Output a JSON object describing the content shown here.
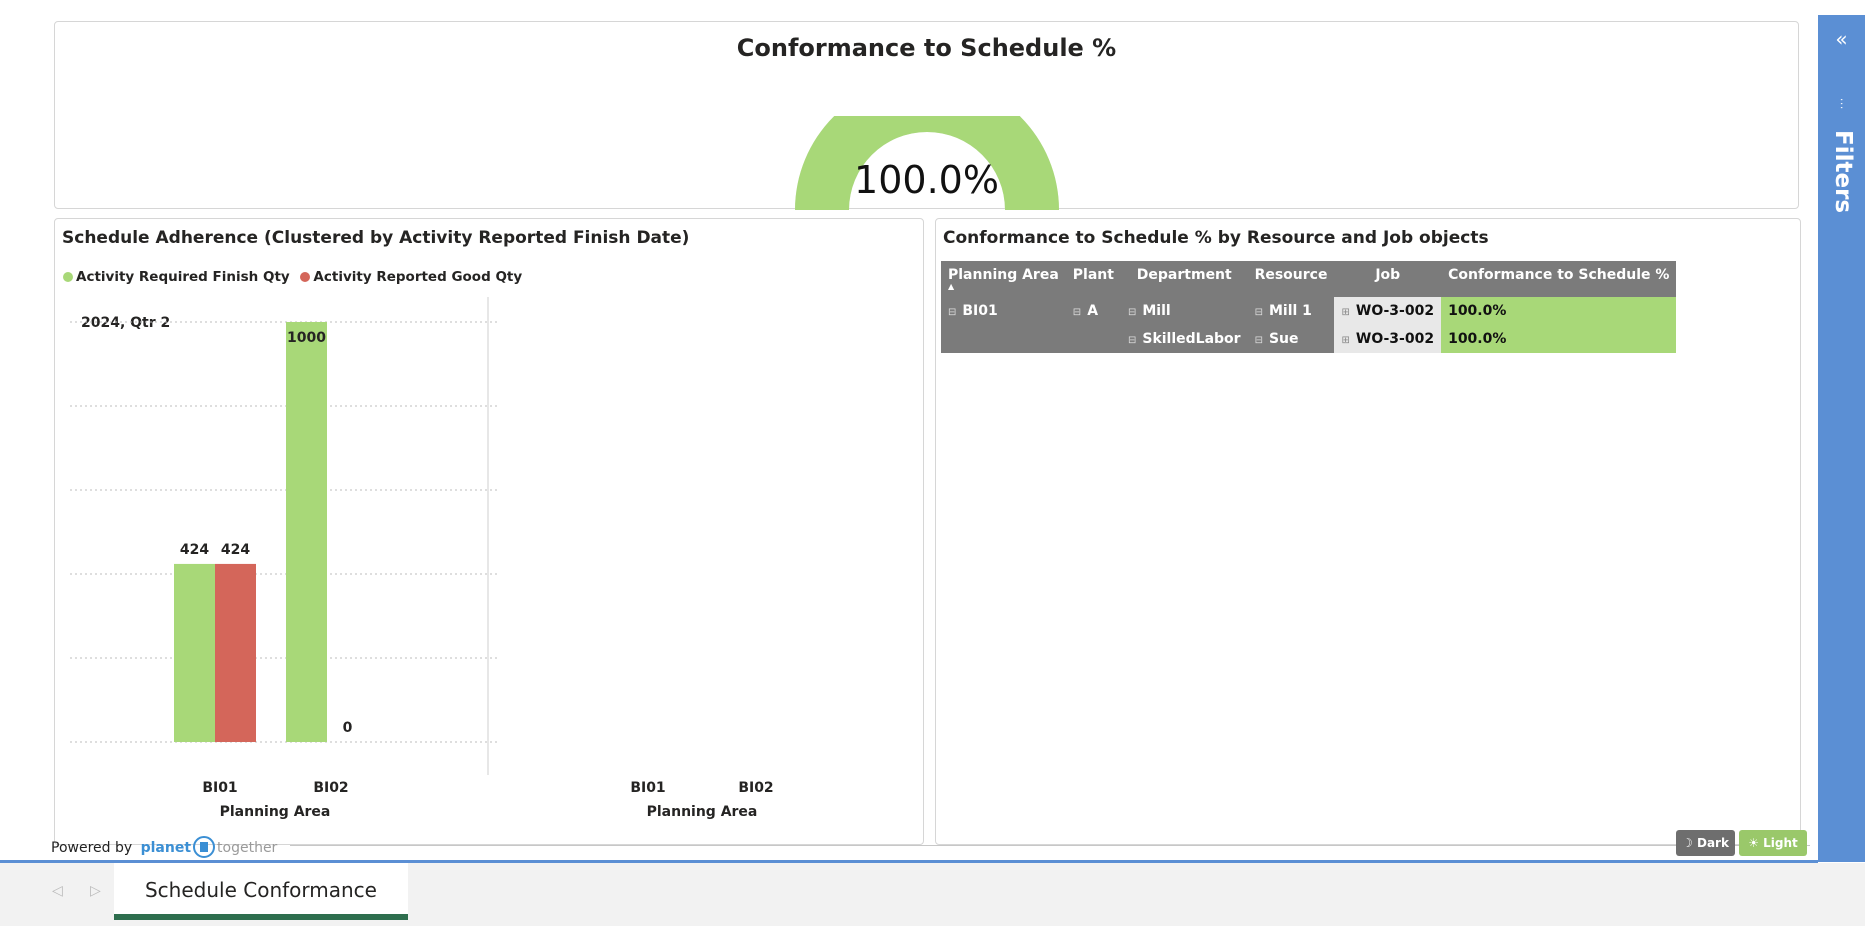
{
  "gauge": {
    "title": "Conformance to Schedule %",
    "value_label": "100.0%",
    "value_fraction": 1.0,
    "fill_color": "#a8d878"
  },
  "chart_card": {
    "title": "Schedule Adherence (Clustered by Activity Reported Finish Date)"
  },
  "chart_data": {
    "type": "bar",
    "period_label": "2024, Qtr 2",
    "categories": [
      "BI01",
      "BI02"
    ],
    "empty_panel_categories": [
      "BI01",
      "BI02"
    ],
    "xlabel": "Planning Area",
    "ylim": [
      0,
      1000
    ],
    "grid": true,
    "legend_position": "top-left",
    "series": [
      {
        "name": "Activity Required Finish Qty",
        "color": "#a8d878",
        "values": [
          424,
          1000
        ]
      },
      {
        "name": "Activity Reported Good Qty",
        "color": "#d4665a",
        "values": [
          424,
          0
        ]
      }
    ]
  },
  "table_card": {
    "title": "Conformance to Schedule % by Resource and Job objects",
    "columns": [
      "Planning Area",
      "Plant",
      "Department",
      "Resource",
      "Job",
      "Conformance to Schedule %"
    ],
    "rows": [
      {
        "planning_area": "BI01",
        "plant": "A",
        "department": "Mill",
        "resource": "Mill 1",
        "job": "WO-3-002",
        "conformance": "100.0%"
      },
      {
        "planning_area": "",
        "plant": "",
        "department": "SkilledLabor",
        "resource": "Sue",
        "job": "WO-3-002",
        "conformance": "100.0%"
      }
    ]
  },
  "filters_pane": {
    "label": "Filters",
    "collapse_icon": "double-chevron-left-icon",
    "filter_icon": "filter-icon"
  },
  "footer": {
    "powered_by": "Powered by",
    "brand_planet": "planet",
    "brand_together": "together",
    "theme_dark": "Dark",
    "theme_light": "Light",
    "theme_dark_icon": "moon-icon",
    "theme_light_icon": "sun-icon"
  },
  "tabs": {
    "active": "Schedule Conformance"
  }
}
